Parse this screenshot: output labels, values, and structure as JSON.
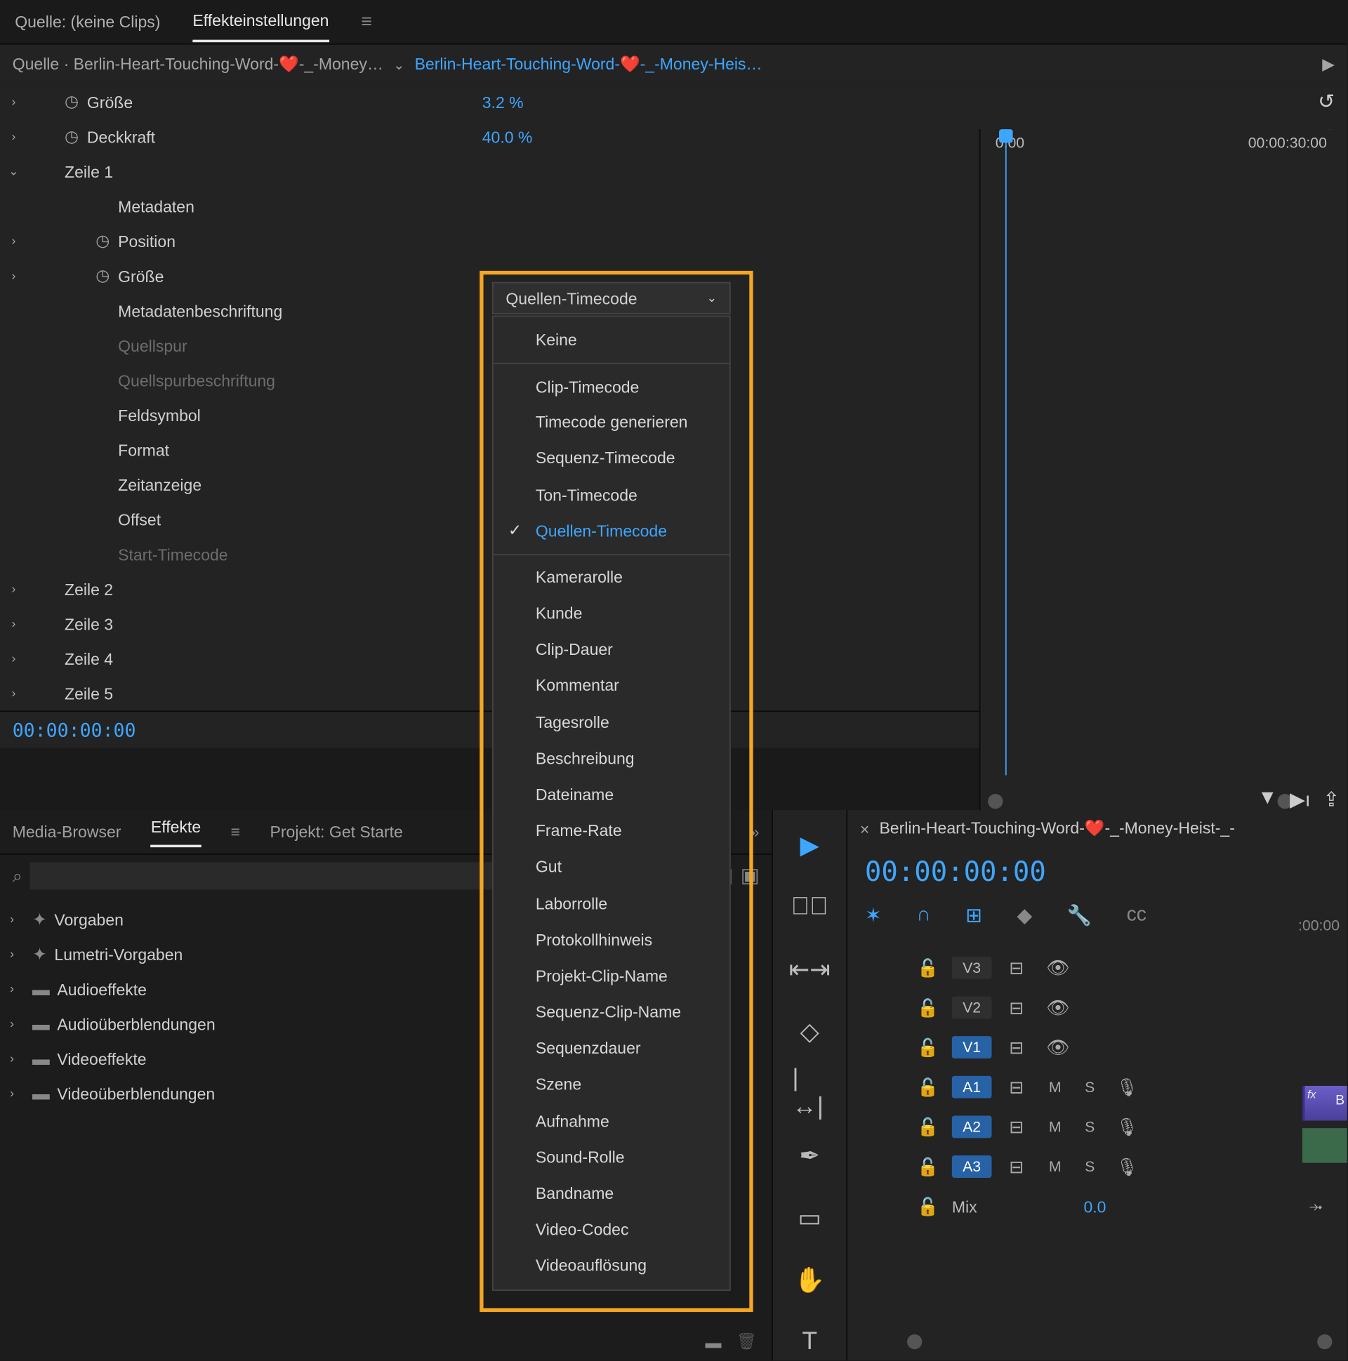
{
  "top_tabs": {
    "source": "Quelle: (keine Clips)",
    "effects": "Effekteinstellungen"
  },
  "source_bar": {
    "src": "Quelle · Berlin-Heart-Touching-Word-❤️-_-Money…",
    "active": "Berlin-Heart-Touching-Word-❤️-_-Money-Heis…"
  },
  "ruler": {
    "t0": "0:00",
    "t1": "00:00:30:00"
  },
  "rows": {
    "groesse": "Größe",
    "groesse_val": "3.2 %",
    "deckkraft": "Deckkraft",
    "deckkraft_val": "40.0 %",
    "zeile1": "Zeile 1",
    "metadaten": "Metadaten",
    "position": "Position",
    "groesse2": "Größe",
    "metalabel": "Metadatenbeschriftung",
    "quellspur": "Quellspur",
    "quellspurb": "Quellspurbeschriftung",
    "feld": "Feldsymbol",
    "format": "Format",
    "zeit": "Zeitanzeige",
    "offset": "Offset",
    "starttc": "Start-Timecode",
    "z2": "Zeile 2",
    "z3": "Zeile 3",
    "z4": "Zeile 4",
    "z5": "Zeile 5"
  },
  "tc": "00:00:00:00",
  "dd_label": "Quellen-Timecode",
  "dd_items": [
    "Keine",
    "Clip-Timecode",
    "Timecode generieren",
    "Sequenz-Timecode",
    "Ton-Timecode",
    "Quellen-Timecode",
    "Kamerarolle",
    "Kunde",
    "Clip-Dauer",
    "Kommentar",
    "Tagesrolle",
    "Beschreibung",
    "Dateiname",
    "Frame-Rate",
    "Gut",
    "Laborrolle",
    "Protokollhinweis",
    "Projekt-Clip-Name",
    "Sequenz-Clip-Name",
    "Sequenzdauer",
    "Szene",
    "Aufnahme",
    "Sound-Rolle",
    "Bandname",
    "Video-Codec",
    "Videoauflösung"
  ],
  "lower_tabs": {
    "media": "Media-Browser",
    "effekte": "Effekte",
    "projekt": "Projekt: Get Starte"
  },
  "folders": [
    "Vorgaben",
    "Lumetri-Vorgaben",
    "Audioeffekte",
    "Audioüberblendungen",
    "Videoeffekte",
    "Videoüberblendungen"
  ],
  "seq_tab": "Berlin-Heart-Touching-Word-❤️-_-Money-Heist-_-",
  "seq_tc": "00:00:00:00",
  "seq_ruler": ":00:00",
  "tracks": {
    "v3": "V3",
    "v2": "V2",
    "v1": "V1",
    "a1": "A1",
    "a2": "A2",
    "a3": "A3",
    "mix": "Mix",
    "mix_val": "0.0"
  },
  "clip_label": "B"
}
